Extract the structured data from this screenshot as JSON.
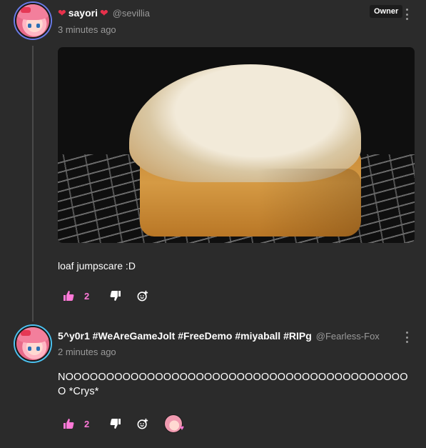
{
  "comments": [
    {
      "username": "sayori",
      "heart_left": "❤",
      "heart_right": "❤",
      "handle": "@sevillia",
      "badge": "Owner",
      "timestamp": "3 minutes ago",
      "image_icon": "bread-loaf-photo",
      "text": "loaf jumpscare :D",
      "likes": "2"
    },
    {
      "username": "5^y0r1 #WeAreGameJolt #FreeDemo #miyaball #RIPg",
      "handle": "@Fearless-Fox",
      "timestamp": "2 minutes ago",
      "text_line1": "NOOOOOOOOOOOOOOOOOOOOOOOOOOOOOOOOOOOOOOOOOO",
      "text_line2": "O *Crys*",
      "likes": "2",
      "reaction_heart": "♥"
    }
  ],
  "icons": {
    "like": "thumbs-up-icon",
    "dislike": "thumbs-down-icon",
    "add_reaction": "add-reaction-icon",
    "more": "more-options-icon"
  },
  "colors": {
    "background": "#2b2b2b",
    "like_count": "#ff79d8",
    "heart": "#e8314b"
  }
}
